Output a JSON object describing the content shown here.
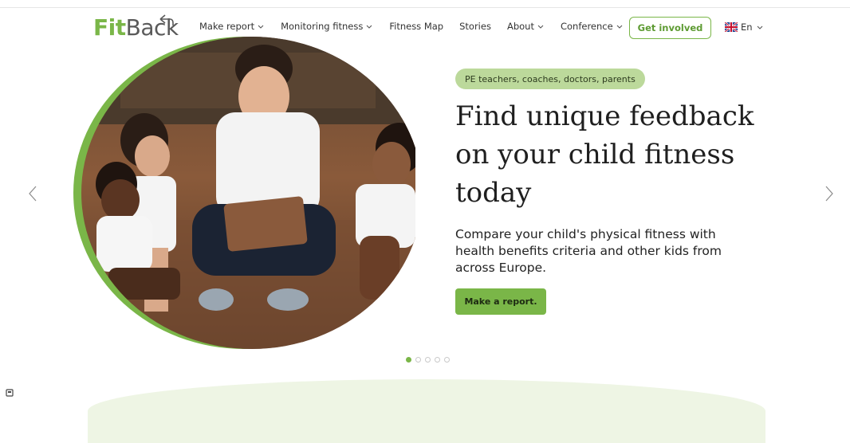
{
  "header": {
    "logo_fit": "Fit",
    "logo_back": "Back",
    "nav": [
      {
        "label": "Make report",
        "dropdown": true
      },
      {
        "label": "Monitoring fitness",
        "dropdown": true
      },
      {
        "label": "Fitness Map",
        "dropdown": false
      },
      {
        "label": "Stories",
        "dropdown": false
      },
      {
        "label": "About",
        "dropdown": true
      },
      {
        "label": "Conference",
        "dropdown": true
      }
    ],
    "cta_label": "Get involved",
    "language": "En"
  },
  "hero": {
    "pill": "PE teachers, coaches, doctors, parents",
    "headline": "Find unique feedback on your child fitness today",
    "subtext": "Compare your child's physical fitness with health benefits criteria and other kids from across Europe.",
    "button_label": "Make a report.",
    "slides_total": 5,
    "active_slide": 1
  },
  "colors": {
    "accent": "#7ab648",
    "pill_bg": "#bcd99b",
    "logo_grey": "#5a5a5a"
  },
  "icons": [
    "undo-arrow-icon",
    "chevron-down-icon",
    "uk-flag-icon",
    "chevron-left-icon",
    "chevron-right-icon",
    "cookie-icon"
  ]
}
